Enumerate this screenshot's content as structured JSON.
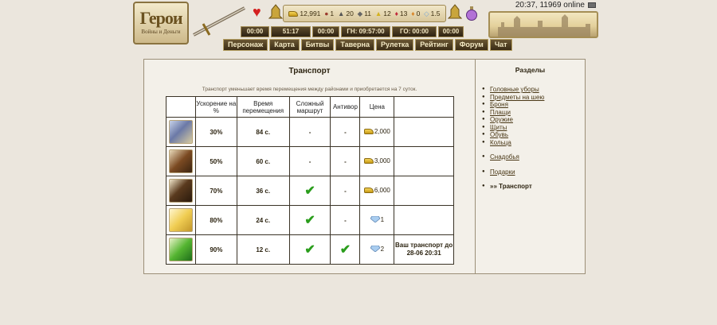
{
  "clock": {
    "time": "20:37, 11969 online"
  },
  "logo": {
    "title": "Герои",
    "subtitle": "Войны и Деньги"
  },
  "stats": [
    {
      "icon": "gold-icon",
      "value": "12,991"
    },
    {
      "icon": "wood-icon",
      "value": "1"
    },
    {
      "icon": "ore-icon",
      "value": "20"
    },
    {
      "icon": "mercury-icon",
      "value": "11"
    },
    {
      "icon": "sulfur-icon",
      "value": "12"
    },
    {
      "icon": "crystal-icon",
      "value": "13"
    },
    {
      "icon": "gems-icon",
      "value": "0"
    },
    {
      "icon": "diamond-icon",
      "value": "1.5"
    }
  ],
  "timers": [
    "00:00",
    "51:17",
    "00:00",
    "ГН: 09:57:00",
    "ГО: 00:00",
    "00:00"
  ],
  "menu": [
    "Персонаж",
    "Карта",
    "Битвы",
    "Таверна",
    "Рулетка",
    "Рейтинг",
    "Форум",
    "Чат"
  ],
  "main": {
    "title": "Транспорт",
    "note": "Транспорт уменьшает время перемещения между районами и приобретается на 7 суток.",
    "headers": [
      "",
      "Ускорение на %",
      "Время перемещения",
      "Сложный маршрут",
      "Антивор",
      "Цена",
      ""
    ],
    "rows": [
      {
        "icon": "bird-mount-icon",
        "speed": "30%",
        "time": "84 с.",
        "hard_route": "-",
        "antithief": "-",
        "price": "2,000",
        "currency": "gold",
        "status": ""
      },
      {
        "icon": "horse-brown-icon",
        "speed": "50%",
        "time": "60 с.",
        "hard_route": "-",
        "antithief": "-",
        "price": "3,000",
        "currency": "gold",
        "status": ""
      },
      {
        "icon": "horse-black-icon",
        "speed": "70%",
        "time": "36 с.",
        "hard_route": "check",
        "antithief": "-",
        "price": "6,000",
        "currency": "gold",
        "status": ""
      },
      {
        "icon": "pegasus-gold-icon",
        "speed": "80%",
        "time": "24 с.",
        "hard_route": "check",
        "antithief": "-",
        "price": "1",
        "currency": "diamond",
        "status": ""
      },
      {
        "icon": "dragon-green-icon",
        "speed": "90%",
        "time": "12 с.",
        "hard_route": "check",
        "antithief": "check",
        "price": "2",
        "currency": "diamond",
        "status": "Ваш транспорт до 28-06 20:31"
      }
    ]
  },
  "sidebar": {
    "title": "Разделы",
    "group1": [
      "Головные уборы",
      "Предметы на шею",
      "Броня",
      "Плащи",
      "Оружие",
      "Щиты",
      "Обувь",
      "Кольца"
    ],
    "group2": [
      "Снадобья"
    ],
    "group3": [
      "Подарки"
    ],
    "current": "»» Транспорт"
  }
}
